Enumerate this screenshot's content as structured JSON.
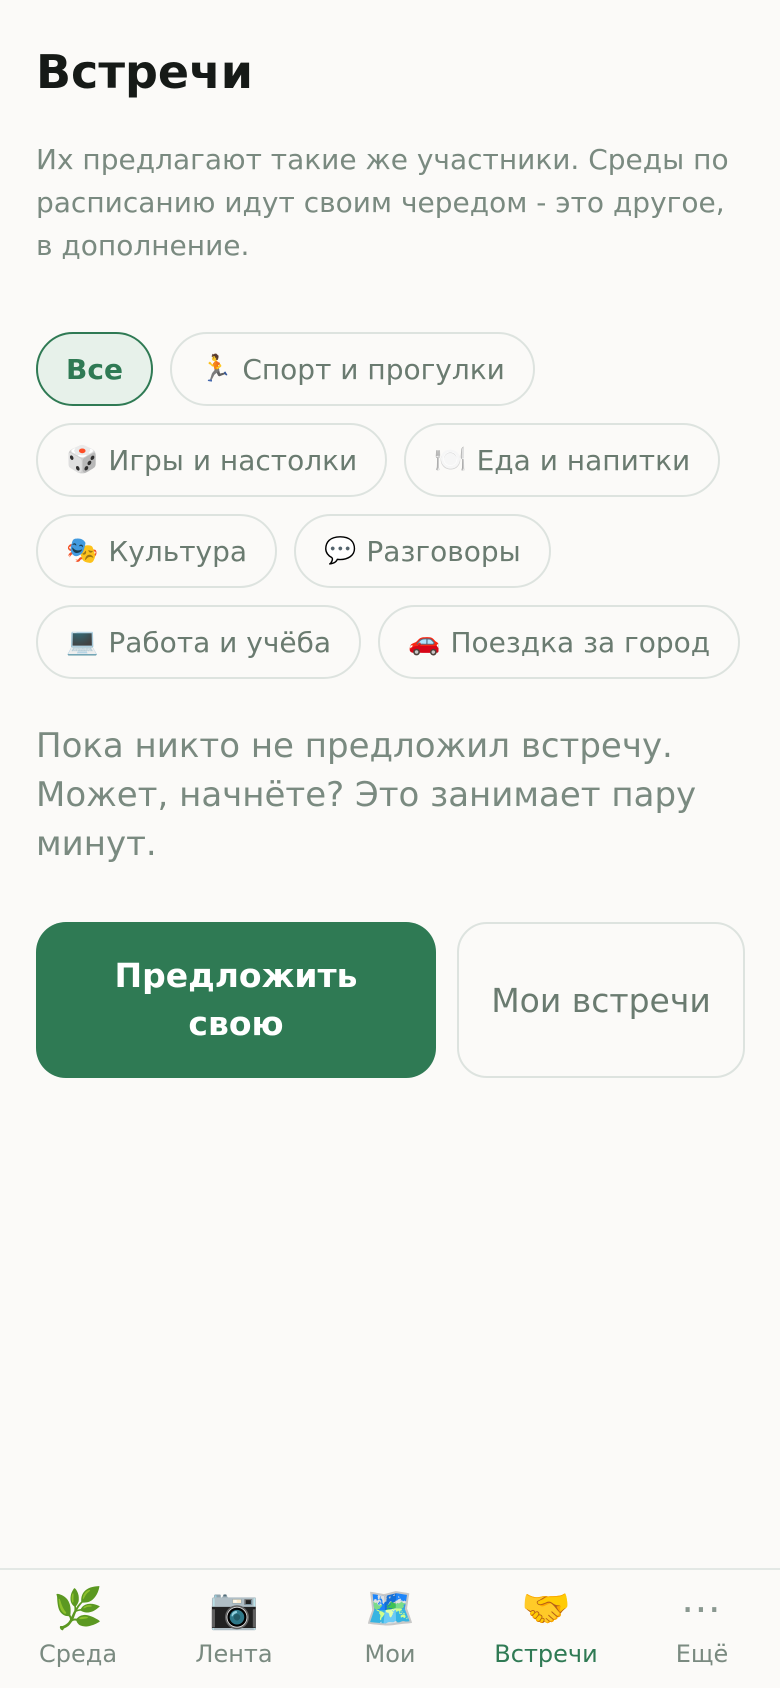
{
  "header": {
    "title": "Встречи",
    "intro": "Их предлагают такие же участники. Среды по расписанию идут своим чередом - это другое, в дополнение."
  },
  "filters": [
    {
      "label": "Все",
      "emoji": "",
      "active": true
    },
    {
      "label": "Спорт и прогулки",
      "emoji": "🏃",
      "active": false
    },
    {
      "label": "Игры и настолки",
      "emoji": "🎲",
      "active": false
    },
    {
      "label": "Еда и напитки",
      "emoji": "🍽️",
      "active": false
    },
    {
      "label": "Культура",
      "emoji": "🎭",
      "active": false
    },
    {
      "label": "Разговоры",
      "emoji": "💬",
      "active": false
    },
    {
      "label": "Работа и учёба",
      "emoji": "💻",
      "active": false
    },
    {
      "label": "Поездка за город",
      "emoji": "🚗",
      "active": false
    }
  ],
  "empty_state": {
    "message": "Пока никто не предложил встречу. Может, начнёте? Это занимает пару минут."
  },
  "actions": {
    "propose_label": "Предложить свою",
    "my_meetups_label": "Мои встречи"
  },
  "tabbar": {
    "items": [
      {
        "label": "Среда",
        "icon": "🌿",
        "icon_name": "herb-icon",
        "active": false
      },
      {
        "label": "Лента",
        "icon": "📷",
        "icon_name": "camera-icon",
        "active": false
      },
      {
        "label": "Мои",
        "icon": "🗺️",
        "icon_name": "map-icon",
        "active": false
      },
      {
        "label": "Встречи",
        "icon": "🤝",
        "icon_name": "handshake-icon",
        "active": true
      },
      {
        "label": "Ещё",
        "icon": "⋯",
        "icon_name": "more-icon",
        "active": false
      }
    ]
  },
  "colors": {
    "accent": "#2f7a54",
    "background": "#fbfaf8",
    "muted_text": "#7a8a80"
  }
}
